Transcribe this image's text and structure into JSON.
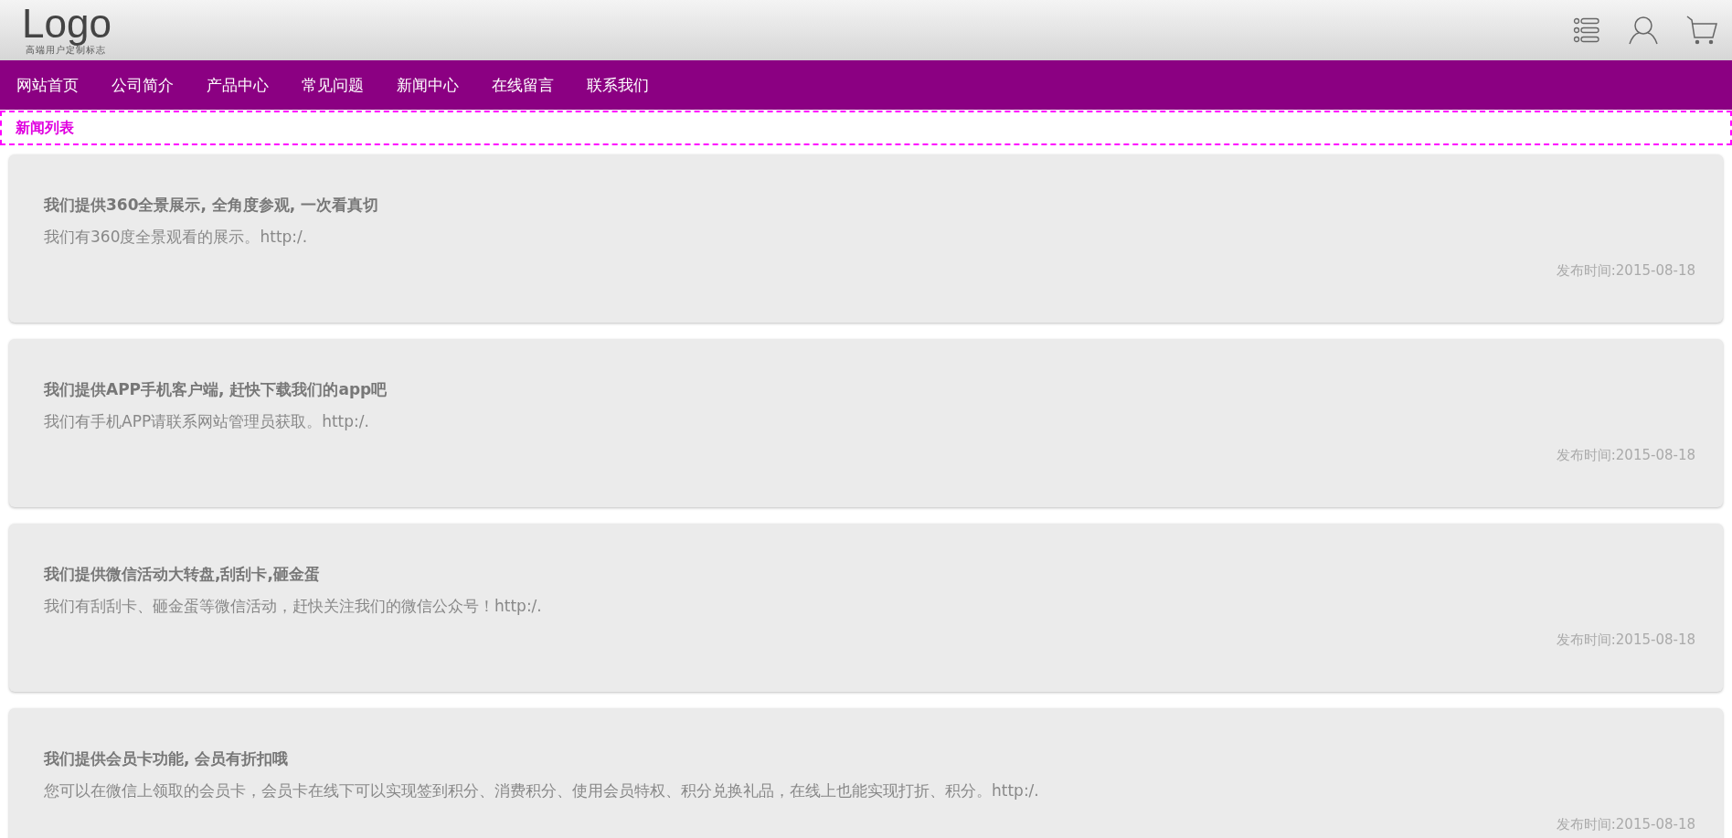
{
  "header": {
    "logo": "Logo",
    "logo_tagline": "高端用户定制标志"
  },
  "nav": {
    "items": [
      {
        "label": "网站首页"
      },
      {
        "label": "公司简介"
      },
      {
        "label": "产品中心"
      },
      {
        "label": "常见问题"
      },
      {
        "label": "新闻中心"
      },
      {
        "label": "在线留言"
      },
      {
        "label": "联系我们"
      }
    ]
  },
  "breadcrumb": "新闻列表",
  "news": [
    {
      "title": "我们提供360全景展示, 全角度参观, 一次看真切",
      "summary": "我们有360度全景观看的展示。http:/.",
      "date": "发布时间:2015-08-18"
    },
    {
      "title": "我们提供APP手机客户端, 赶快下载我们的app吧",
      "summary": "我们有手机APP请联系网站管理员获取。http:/.",
      "date": "发布时间:2015-08-18"
    },
    {
      "title": "我们提供微信活动大转盘,刮刮卡,砸金蛋",
      "summary": "我们有刮刮卡、砸金蛋等微信活动，赶快关注我们的微信公众号！http:/.",
      "date": "发布时间:2015-08-18"
    },
    {
      "title": "我们提供会员卡功能, 会员有折扣哦",
      "summary": "您可以在微信上领取的会员卡，会员卡在线下可以实现签到积分、消费积分、使用会员特权、积分兑换礼品，在线上也能实现打折、积分。http:/.",
      "date": "发布时间:2015-08-18"
    }
  ]
}
